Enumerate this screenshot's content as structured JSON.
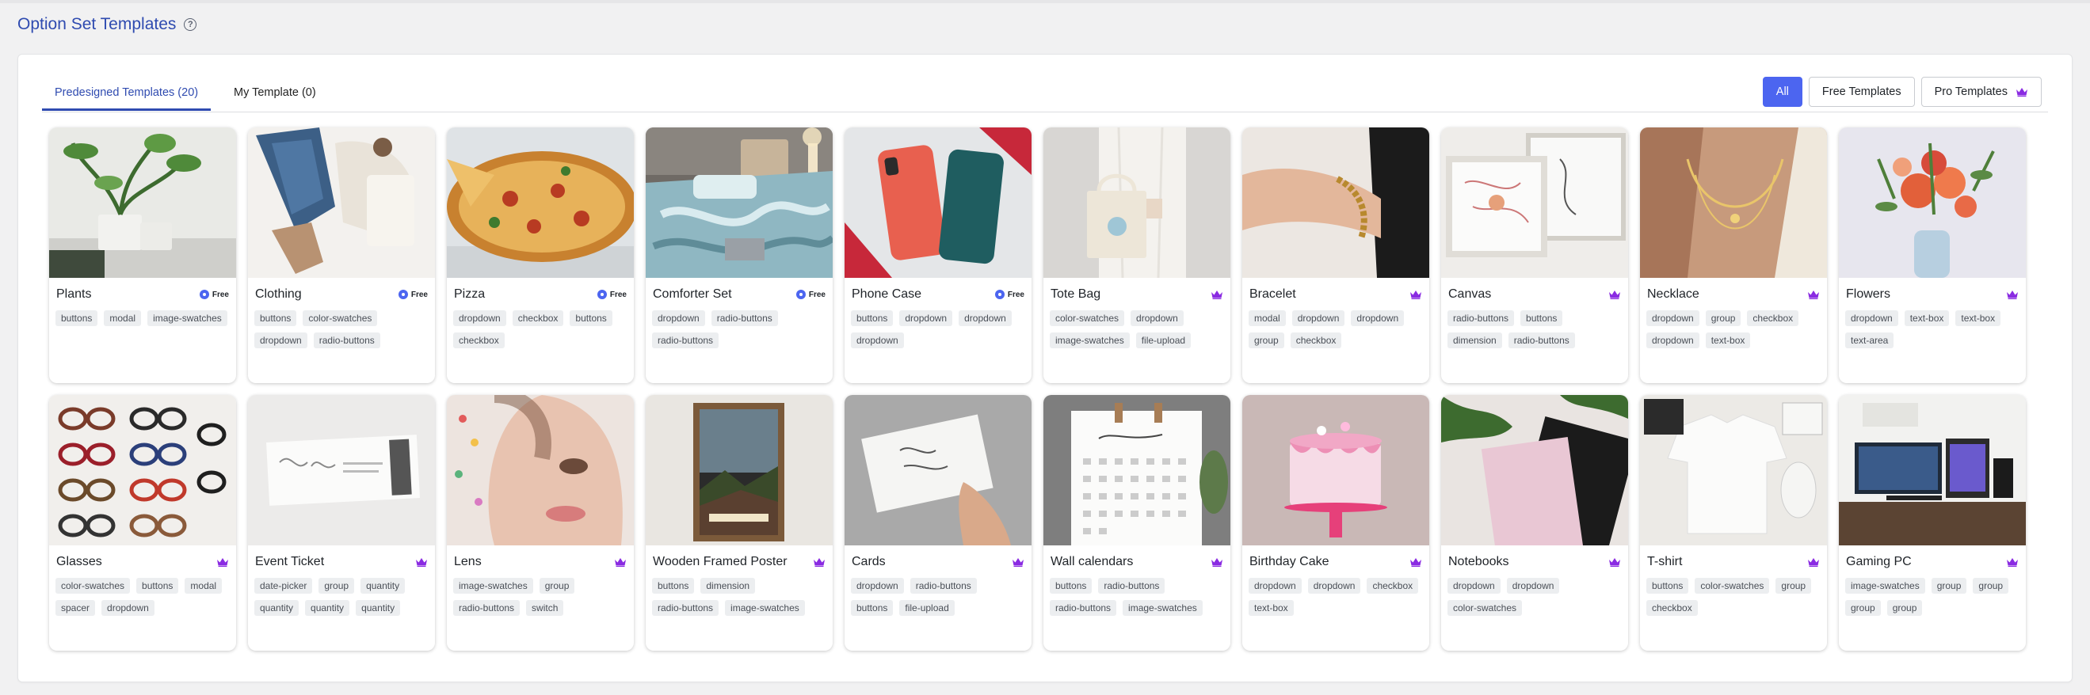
{
  "header": {
    "title": "Option Set Templates"
  },
  "tabs": [
    {
      "label": "Predesigned Templates (20)",
      "active": true
    },
    {
      "label": "My Template (0)",
      "active": false
    }
  ],
  "filters": [
    {
      "label": "All",
      "active": true
    },
    {
      "label": "Free Templates",
      "active": false
    },
    {
      "label": "Pro Templates",
      "active": false,
      "icon": "crown-icon"
    }
  ],
  "colors": {
    "accent": "#4c65f0",
    "title": "#2f4bb0",
    "crown": "#8a2be2"
  },
  "templates": [
    {
      "title": "Plants",
      "badge": "free",
      "badge_label": "Free",
      "image": "plants",
      "tags": [
        "buttons",
        "modal",
        "image-swatches"
      ]
    },
    {
      "title": "Clothing",
      "badge": "free",
      "badge_label": "Free",
      "image": "clothing",
      "tags": [
        "buttons",
        "color-swatches",
        "dropdown",
        "radio-buttons"
      ]
    },
    {
      "title": "Pizza",
      "badge": "free",
      "badge_label": "Free",
      "image": "pizza",
      "tags": [
        "dropdown",
        "checkbox",
        "buttons",
        "checkbox"
      ]
    },
    {
      "title": "Comforter Set",
      "badge": "free",
      "badge_label": "Free",
      "image": "comforter",
      "tags": [
        "dropdown",
        "radio-buttons",
        "radio-buttons"
      ]
    },
    {
      "title": "Phone Case",
      "badge": "free",
      "badge_label": "Free",
      "image": "phone",
      "tags": [
        "buttons",
        "dropdown",
        "dropdown",
        "dropdown"
      ]
    },
    {
      "title": "Tote Bag",
      "badge": "pro",
      "image": "tote",
      "tags": [
        "color-swatches",
        "dropdown",
        "image-swatches",
        "file-upload"
      ]
    },
    {
      "title": "Bracelet",
      "badge": "pro",
      "image": "bracelet",
      "tags": [
        "modal",
        "dropdown",
        "dropdown",
        "group",
        "checkbox"
      ]
    },
    {
      "title": "Canvas",
      "badge": "pro",
      "image": "canvas",
      "tags": [
        "radio-buttons",
        "buttons",
        "dimension",
        "radio-buttons"
      ]
    },
    {
      "title": "Necklace",
      "badge": "pro",
      "image": "necklace",
      "tags": [
        "dropdown",
        "group",
        "checkbox",
        "dropdown",
        "text-box"
      ]
    },
    {
      "title": "Flowers",
      "badge": "pro",
      "image": "flowers",
      "tags": [
        "dropdown",
        "text-box",
        "text-box",
        "text-area"
      ]
    },
    {
      "title": "Glasses",
      "badge": "pro",
      "image": "glasses",
      "tags": [
        "color-swatches",
        "buttons",
        "modal",
        "spacer",
        "dropdown"
      ]
    },
    {
      "title": "Event Ticket",
      "badge": "pro",
      "image": "ticket",
      "tags": [
        "date-picker",
        "group",
        "quantity",
        "quantity",
        "quantity",
        "quantity"
      ]
    },
    {
      "title": "Lens",
      "badge": "pro",
      "image": "lens",
      "tags": [
        "image-swatches",
        "group",
        "radio-buttons",
        "switch"
      ]
    },
    {
      "title": "Wooden Framed Poster",
      "badge": "pro",
      "image": "poster",
      "tags": [
        "buttons",
        "dimension",
        "radio-buttons",
        "image-swatches"
      ]
    },
    {
      "title": "Cards",
      "badge": "pro",
      "image": "cards",
      "tags": [
        "dropdown",
        "radio-buttons",
        "buttons",
        "file-upload"
      ]
    },
    {
      "title": "Wall calendars",
      "badge": "pro",
      "image": "calendar",
      "tags": [
        "buttons",
        "radio-buttons",
        "radio-buttons",
        "image-swatches"
      ]
    },
    {
      "title": "Birthday Cake",
      "badge": "pro",
      "image": "cake",
      "tags": [
        "dropdown",
        "dropdown",
        "checkbox",
        "text-box"
      ]
    },
    {
      "title": "Notebooks",
      "badge": "pro",
      "image": "notebooks",
      "tags": [
        "dropdown",
        "dropdown",
        "color-swatches"
      ]
    },
    {
      "title": "T-shirt",
      "badge": "pro",
      "image": "tshirt",
      "tags": [
        "buttons",
        "color-swatches",
        "group",
        "checkbox"
      ]
    },
    {
      "title": "Gaming PC",
      "badge": "pro",
      "image": "gaming",
      "tags": [
        "image-swatches",
        "group",
        "group",
        "group",
        "group"
      ]
    }
  ]
}
